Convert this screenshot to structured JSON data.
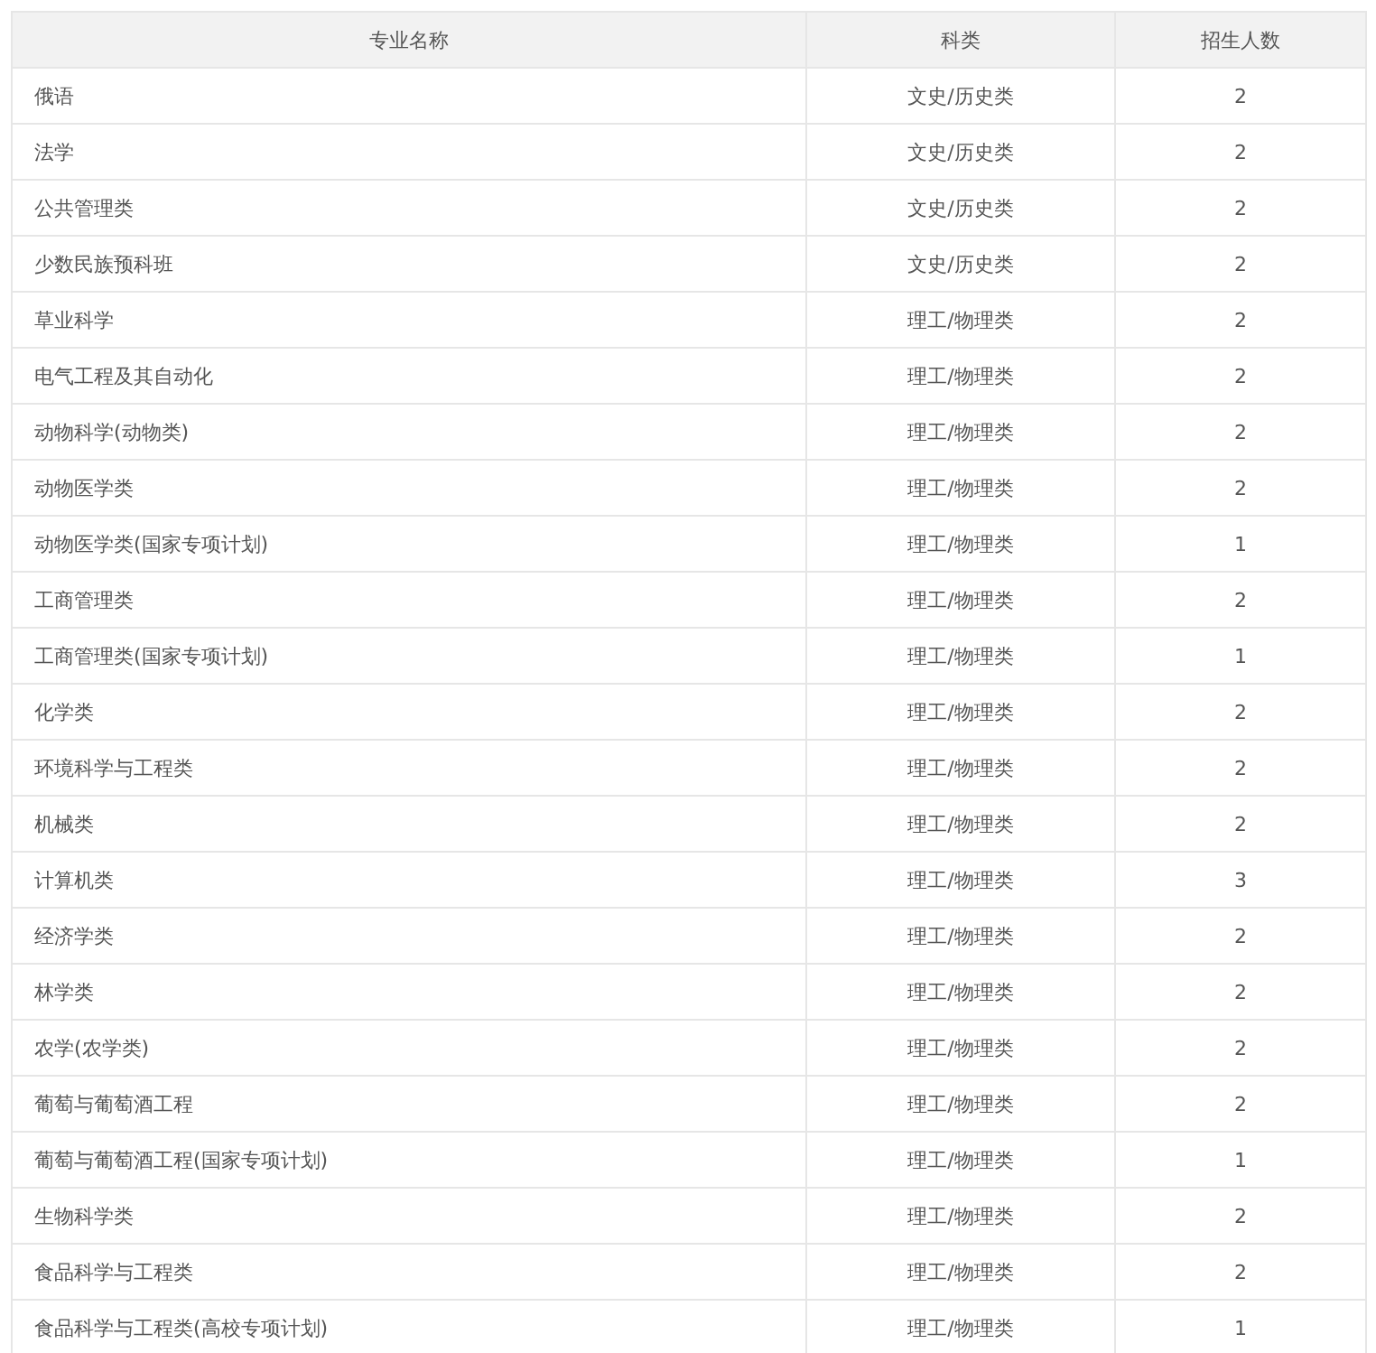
{
  "table": {
    "columns": [
      "专业名称",
      "科类",
      "招生人数"
    ],
    "rows": [
      [
        "俄语",
        "文史/历史类",
        "2"
      ],
      [
        "法学",
        "文史/历史类",
        "2"
      ],
      [
        "公共管理类",
        "文史/历史类",
        "2"
      ],
      [
        "少数民族预科班",
        "文史/历史类",
        "2"
      ],
      [
        "草业科学",
        "理工/物理类",
        "2"
      ],
      [
        "电气工程及其自动化",
        "理工/物理类",
        "2"
      ],
      [
        "动物科学(动物类)",
        "理工/物理类",
        "2"
      ],
      [
        "动物医学类",
        "理工/物理类",
        "2"
      ],
      [
        "动物医学类(国家专项计划)",
        "理工/物理类",
        "1"
      ],
      [
        "工商管理类",
        "理工/物理类",
        "2"
      ],
      [
        "工商管理类(国家专项计划)",
        "理工/物理类",
        "1"
      ],
      [
        "化学类",
        "理工/物理类",
        "2"
      ],
      [
        "环境科学与工程类",
        "理工/物理类",
        "2"
      ],
      [
        "机械类",
        "理工/物理类",
        "2"
      ],
      [
        "计算机类",
        "理工/物理类",
        "3"
      ],
      [
        "经济学类",
        "理工/物理类",
        "2"
      ],
      [
        "林学类",
        "理工/物理类",
        "2"
      ],
      [
        "农学(农学类)",
        "理工/物理类",
        "2"
      ],
      [
        "葡萄与葡萄酒工程",
        "理工/物理类",
        "2"
      ],
      [
        "葡萄与葡萄酒工程(国家专项计划)",
        "理工/物理类",
        "1"
      ],
      [
        "生物科学类",
        "理工/物理类",
        "2"
      ],
      [
        "食品科学与工程类",
        "理工/物理类",
        "2"
      ],
      [
        "食品科学与工程类(高校专项计划)",
        "理工/物理类",
        "1"
      ]
    ]
  }
}
